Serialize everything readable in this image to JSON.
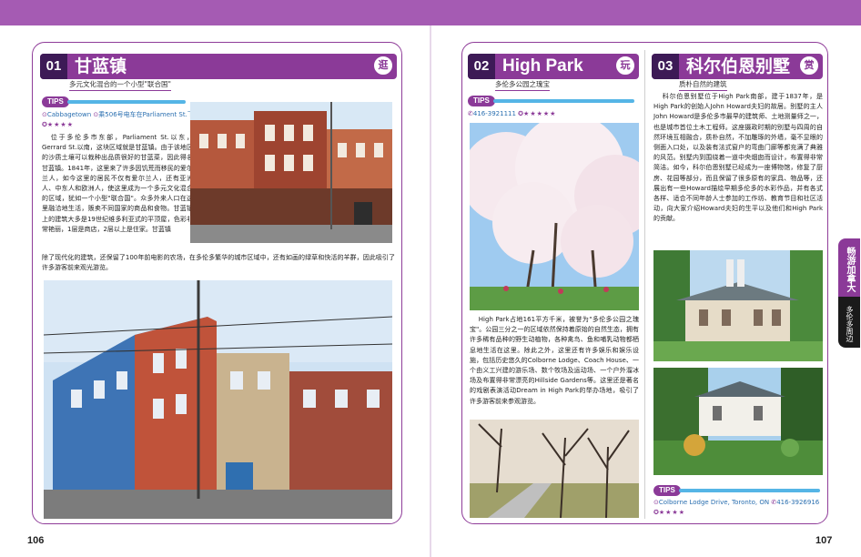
{
  "left_page": {
    "page_number": "106",
    "section": {
      "number": "01",
      "title": "甘蓝镇",
      "badge": "逛",
      "subtitle": "多元文化混合的一个小型\"联合国\""
    },
    "tips": {
      "label": "TIPS",
      "location": "Cabbagetown",
      "transit": "乘506号电车在Parliament St.下",
      "rating": "★★★★"
    },
    "paragraph_top": "位于多伦多市东部，Parliament St.以东，Gerrard St.以南，这块区域就是甘蓝镇。由于该地区的沙质土壤可以栽种出品质很好的甘蓝菜，因此得名甘蓝镇。1841年，这里来了许多因饥荒而移民的爱尔兰人，如今这里的居民不仅有爱尔兰人，还有亚洲人、中东人和欧洲人，使这里成为一个多元文化混合的区域，犹如一个小型\"联合国\"。众多外来人口在这里融洽地生活，贩卖不同国家的商品和食物。甘蓝镇上的建筑大多是19世纪维多利亚式的平顶屋，色彩非常艳丽，1层是商店，2层以上是住家。甘蓝镇",
    "paragraph_full": "除了现代化的建筑，还保留了100年前电影的农场，在多伦多繁华的城市区域中，还有如画的绿草和快活的羊群，因此吸引了许多游客前来观光游览。"
  },
  "right_page": {
    "page_number": "107",
    "section2": {
      "number": "02",
      "title": "High Park",
      "badge": "玩",
      "subtitle": "多伦多公园之瑰宝"
    },
    "tips2": {
      "label": "TIPS",
      "phone": "416-3921111",
      "rating": "★★★★★"
    },
    "paragraph2": "High Park占地161平方千米，被誉为\"多伦多公园之瑰宝\"。公园三分之一的区域依然保持着原始的自然生态，拥有许多稀有品种的野生动植物，各种禽鸟、鱼和哺乳动物都栖息地生活在这里。除此之外，这里还有许多娱乐和娱乐设施，包括历史悠久的Colborne Lodge、Coach House、一个由义工兴建的游乐场、数个牧场及运动场、一个户外溜冰场及布置得非常漂亮的Hillside Gardens等。这里还是著名的戏剧表演活动Dream in High Park的举办场地，吸引了许多游客前来参观游览。",
    "section3": {
      "number": "03",
      "title": "科尔伯恩别墅",
      "badge": "赏",
      "subtitle": "质朴自然的建筑"
    },
    "paragraph3": "科尔伯恩别墅位于High Park南部，建于1837年，是High Park的创始人John Howard夫妇的故居。别墅的主人John Howard是多伦多市最早的建筑师、土地测量师之一，也是城市首位土木工程师。这座摄政时期的别墅与四周的自然环境互相融合，质朴自然，不加雕琢的外墙，毫不显眼的侧面入口处，以及装有法式窗户的弯曲门廊等都充满了典雅的风范。别墅内到围绕着一道中央烟囱而设计，布置得非常简洁。如今，科尔伯恩别墅已经成为一座博物馆，修复了厨房、花园等部分，而且保留了很多原有的家具、物品等，还展出有一些Howard描绘早期多伦多的水彩作品，并有各式各样、适合不同年龄人士参加的工作坊、教育节目和社区活动，向大家介绍Howard夫妇的生平以及他们和High Park的贡献。",
    "tips3": {
      "label": "TIPS",
      "address": "Colborne Lodge Drive, Toronto, ON",
      "phone": "416-3926916",
      "rating": "★★★★"
    }
  },
  "side_tab": {
    "main": "畅游加拿大",
    "sub": "多伦多周边"
  },
  "colors": {
    "accent": "#8b3a98",
    "band": "#a55bb3",
    "number_box": "#3d1a56",
    "tips_line": "#55b5e6"
  }
}
